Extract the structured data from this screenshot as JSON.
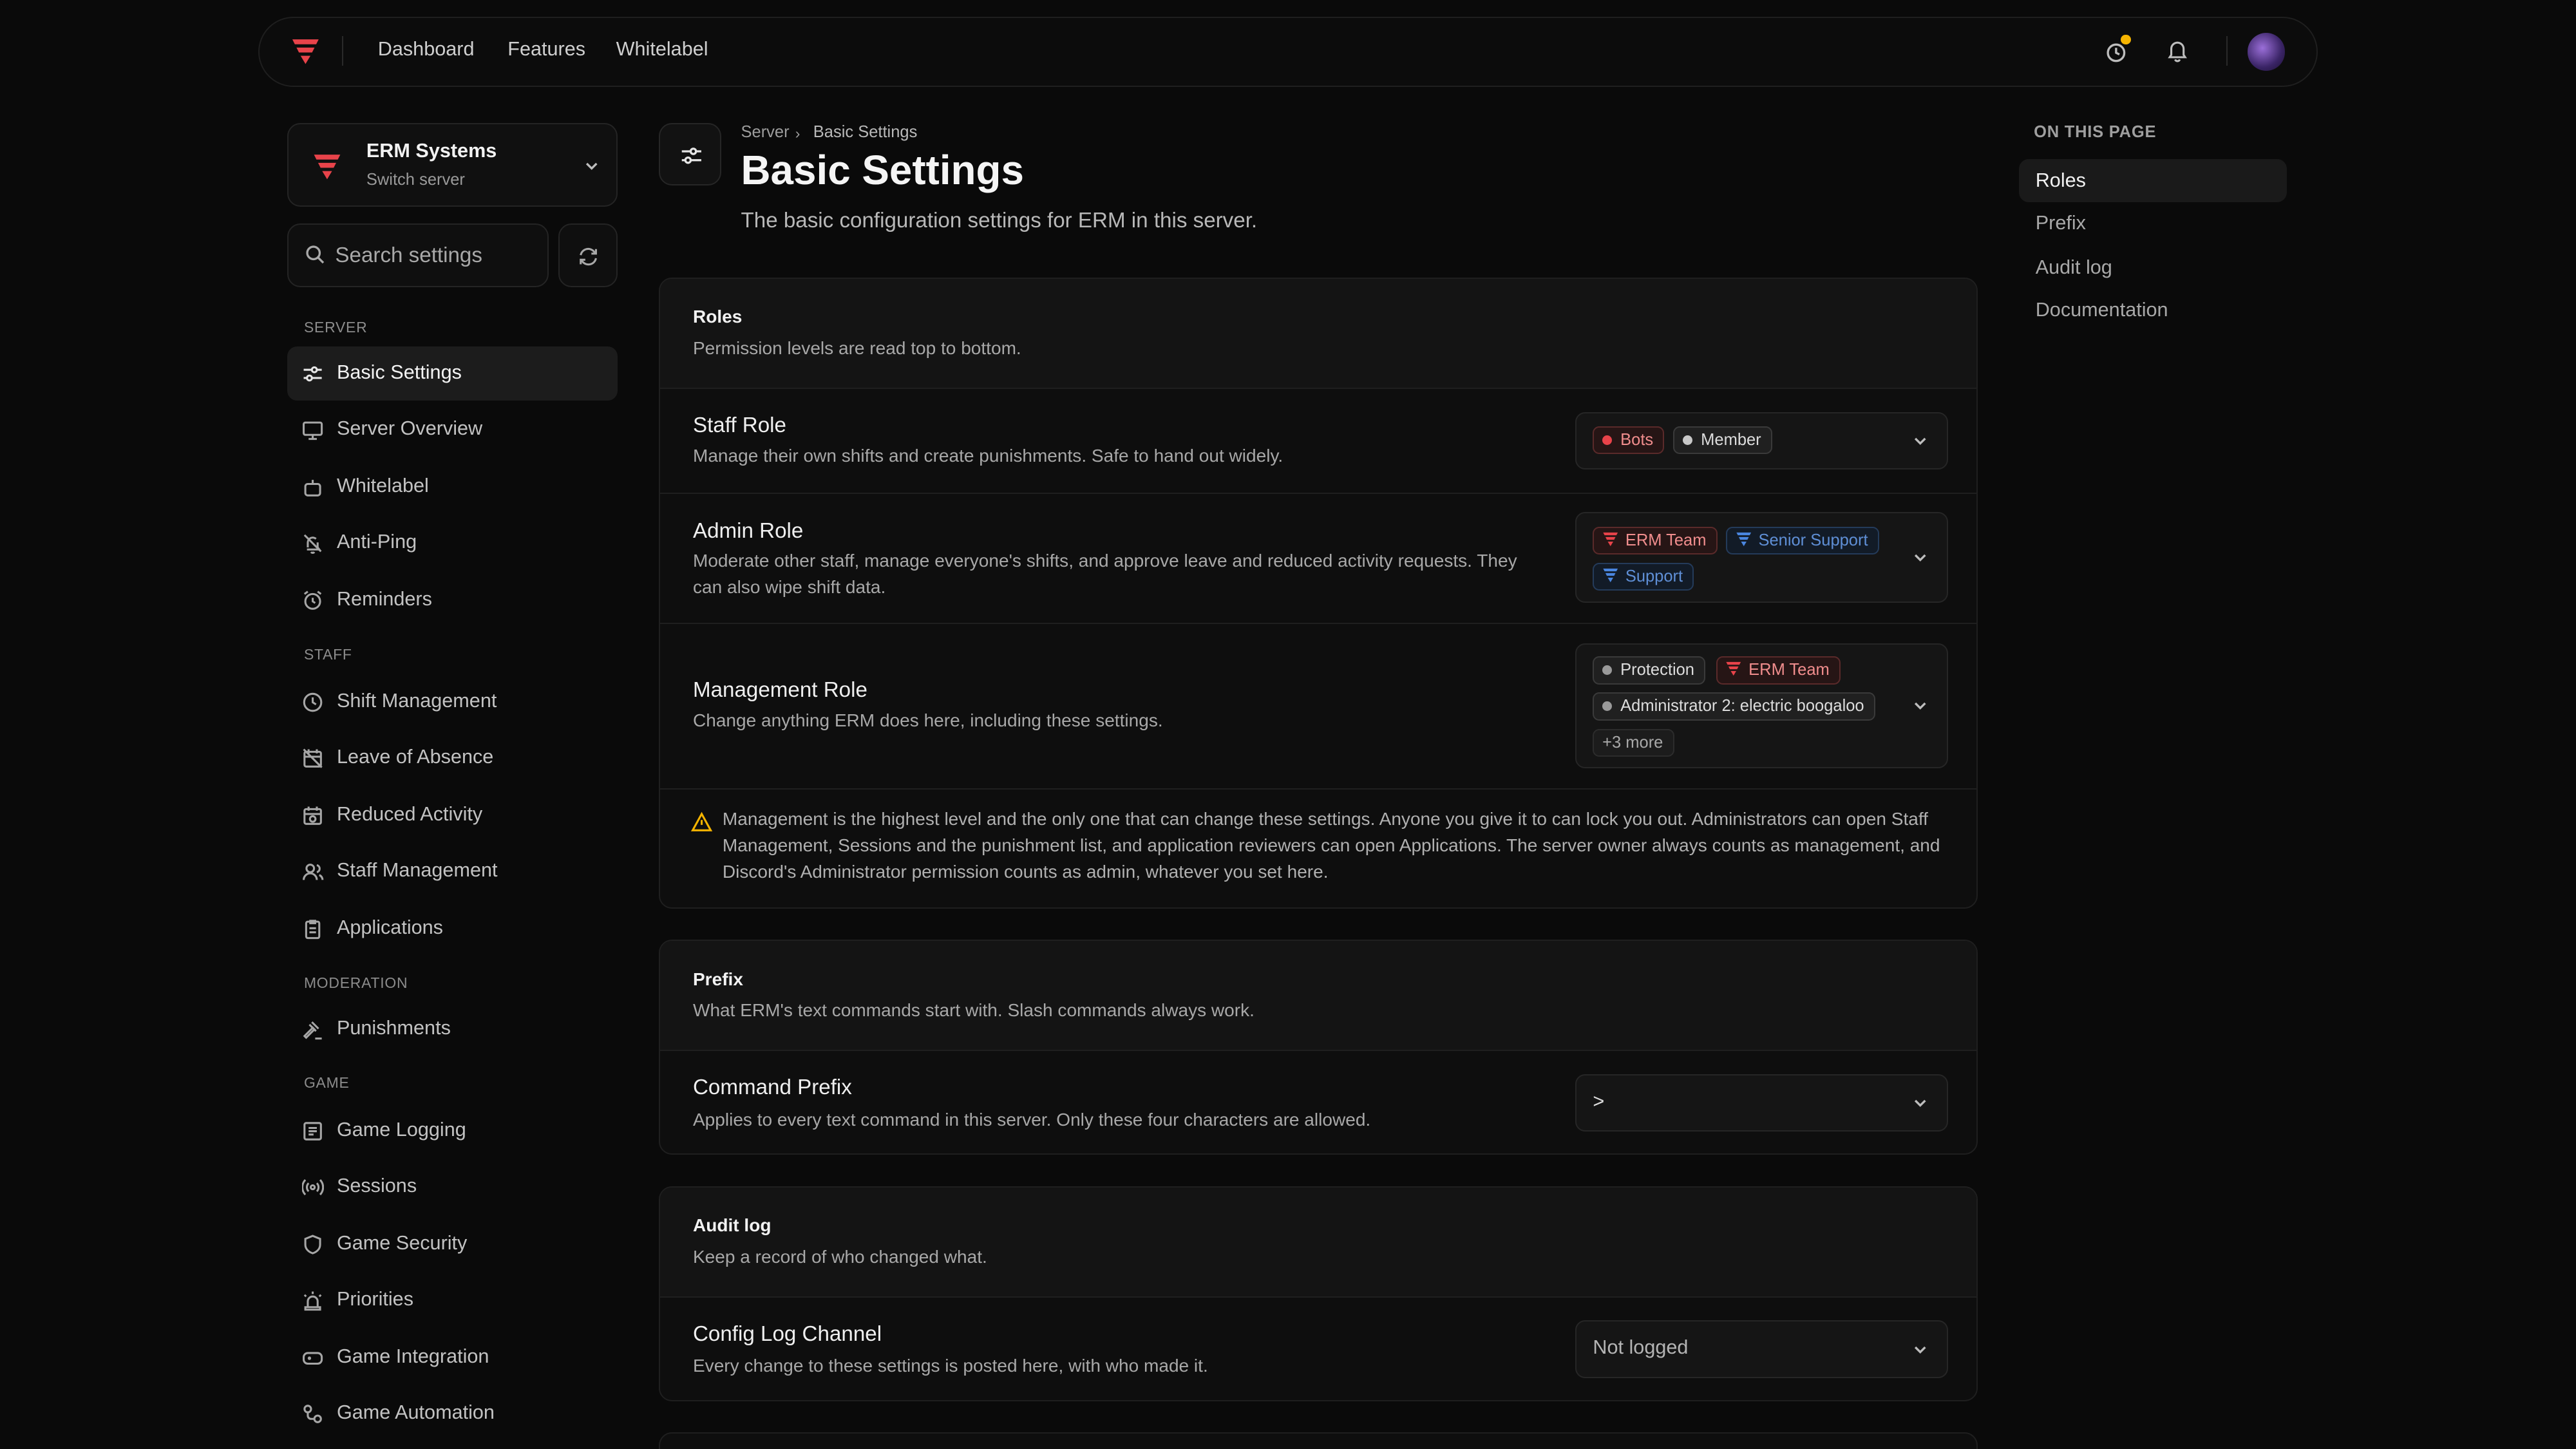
{
  "nav": {
    "links": [
      "Dashboard",
      "Features",
      "Whitelabel"
    ]
  },
  "sidebar": {
    "server_name": "ERM Systems",
    "server_sub": "Switch server",
    "search_placeholder": "Search settings",
    "sections": [
      {
        "label": "SERVER",
        "items": [
          {
            "label": "Basic Settings",
            "icon": "sliders-icon",
            "active": true
          },
          {
            "label": "Server Overview",
            "icon": "monitor-icon"
          },
          {
            "label": "Whitelabel",
            "icon": "bot-icon"
          },
          {
            "label": "Anti-Ping",
            "icon": "bell-off-icon"
          },
          {
            "label": "Reminders",
            "icon": "alarm-clock-icon"
          }
        ]
      },
      {
        "label": "STAFF",
        "items": [
          {
            "label": "Shift Management",
            "icon": "clock-icon"
          },
          {
            "label": "Leave of Absence",
            "icon": "calendar-off-icon"
          },
          {
            "label": "Reduced Activity",
            "icon": "calendar-clock-icon"
          },
          {
            "label": "Staff Management",
            "icon": "users-icon"
          },
          {
            "label": "Applications",
            "icon": "clipboard-icon"
          }
        ]
      },
      {
        "label": "MODERATION",
        "items": [
          {
            "label": "Punishments",
            "icon": "gavel-icon"
          }
        ]
      },
      {
        "label": "GAME",
        "items": [
          {
            "label": "Game Logging",
            "icon": "logs-icon"
          },
          {
            "label": "Sessions",
            "icon": "radio-icon"
          },
          {
            "label": "Game Security",
            "icon": "shield-icon"
          },
          {
            "label": "Priorities",
            "icon": "siren-icon"
          },
          {
            "label": "Game Integration",
            "icon": "gamepad-icon"
          },
          {
            "label": "Game Automation",
            "icon": "workflow-icon"
          }
        ]
      }
    ]
  },
  "header": {
    "breadcrumb": [
      "Server",
      "Basic Settings"
    ],
    "title": "Basic Settings",
    "subtitle": "The basic configuration settings for ERM in this server."
  },
  "cards": {
    "roles": {
      "title": "Roles",
      "desc": "Permission levels are read top to bottom.",
      "staff": {
        "title": "Staff Role",
        "desc": "Manage their own shifts and create punishments. Safe to hand out widely.",
        "chips": [
          "Bots",
          "Member"
        ]
      },
      "admin": {
        "title": "Admin Role",
        "desc": "Moderate other staff, manage everyone's shifts, and approve leave and reduced activity requests. They can also wipe shift data.",
        "chips": [
          "ERM Team",
          "Senior Support",
          "Support"
        ]
      },
      "management": {
        "title": "Management Role",
        "desc": "Change anything ERM does here, including these settings.",
        "chips": [
          "Protection",
          "ERM Team",
          "Administrator 2: electric boogaloo",
          "+3 more"
        ]
      },
      "warning": "Management is the highest level and the only one that can change these settings. Anyone you give it to can lock you out. Administrators can open Staff Management, Sessions and the punishment list, and application reviewers can open Applications. The server owner always counts as management, and Discord's Administrator permission counts as admin, whatever you set here."
    },
    "prefix": {
      "title": "Prefix",
      "desc": "What ERM's text commands start with. Slash commands always work.",
      "row_title": "Command Prefix",
      "row_desc": "Applies to every text command in this server. Only these four characters are allowed.",
      "value": ">"
    },
    "audit": {
      "title": "Audit log",
      "desc": "Keep a record of who changed what.",
      "row_title": "Config Log Channel",
      "row_desc": "Every change to these settings is posted here, with who made it.",
      "value": "Not logged"
    }
  },
  "toc": {
    "label": "ON THIS PAGE",
    "items": [
      "Roles",
      "Prefix",
      "Audit log",
      "Documentation"
    ]
  },
  "colors": {
    "accent": "#e8434a",
    "notification_dot": "#f5b400"
  }
}
